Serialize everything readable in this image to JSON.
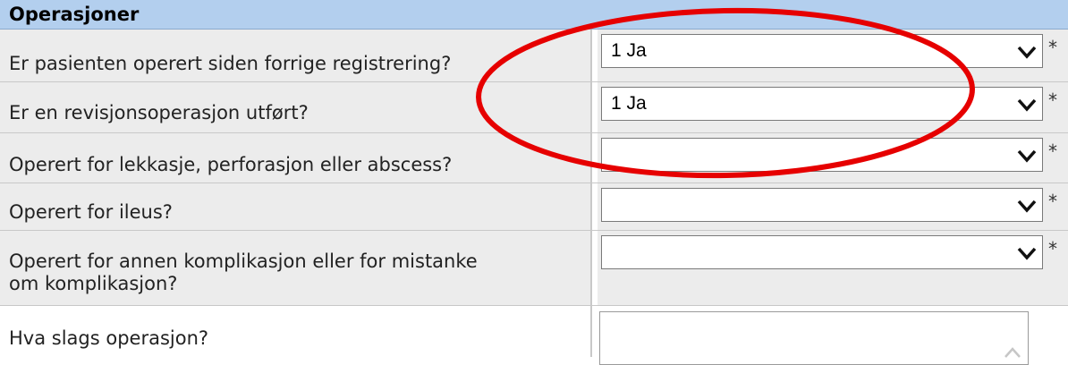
{
  "section": {
    "title": "Operasjoner"
  },
  "rows": [
    {
      "question": "Er pasienten operert siden forrige registrering?",
      "selected": "1 Ja",
      "required": "*"
    },
    {
      "question": "Er en revisjonsoperasjon utført?",
      "selected": "1 Ja",
      "required": "*"
    },
    {
      "question": "Operert for lekkasje, perforasjon eller abscess?",
      "selected": "",
      "required": "*"
    },
    {
      "question": "Operert for ileus?",
      "selected": "",
      "required": "*"
    },
    {
      "question_line1": "Operert for annen komplikasjon eller for mistanke",
      "question_line2": "om komplikasjon?",
      "selected": "",
      "required": "*"
    }
  ],
  "free_text": {
    "question": "Hva slags operasjon?",
    "value": ""
  },
  "icons": {
    "dropdown": "chevron-down-icon",
    "scroll": "chevron-up-icon"
  },
  "colors": {
    "header_bg": "#b3cfee",
    "annotation": "#e60000",
    "row_bg": "#ececec"
  }
}
